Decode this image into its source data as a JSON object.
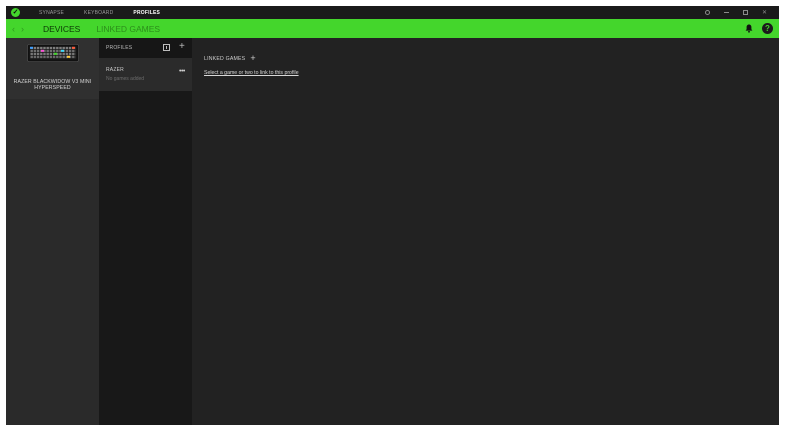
{
  "titlebar": {
    "tabs": [
      {
        "label": "SYNAPSE",
        "active": false
      },
      {
        "label": "KEYBOARD",
        "active": false
      },
      {
        "label": "PROFILES",
        "active": true
      }
    ],
    "logo_icon": "razer-logo-icon",
    "controls": [
      "settings-icon",
      "minimize-icon",
      "maximize-icon",
      "close-icon"
    ]
  },
  "navbar": {
    "tabs": [
      {
        "label": "DEVICES",
        "active": true
      },
      {
        "label": "LINKED GAMES",
        "active": false
      }
    ],
    "back_icon": "chevron-left-icon",
    "forward_icon": "chevron-right-icon",
    "bell_icon": "bell-icon",
    "help_label": "?"
  },
  "devices": {
    "items": [
      {
        "name": "RAZER BLACKWIDOW V3 MINI HYPERSPEED",
        "icon": "keyboard-icon"
      }
    ]
  },
  "profiles": {
    "title": "PROFILES",
    "import_icon": "import-icon",
    "add_label": "+",
    "items": [
      {
        "name": "RAZER",
        "subtitle": "No games added",
        "more_label": "•••"
      }
    ]
  },
  "linked_games": {
    "title": "LINKED GAMES",
    "add_label": "+",
    "link_text": "Select a game or two to link to this profile"
  },
  "colors": {
    "accent": "#44d62c",
    "background": "#222222",
    "titlebar": "#1a1a1a",
    "profiles_panel": "#181818",
    "devices_panel": "#2a2a2a"
  }
}
